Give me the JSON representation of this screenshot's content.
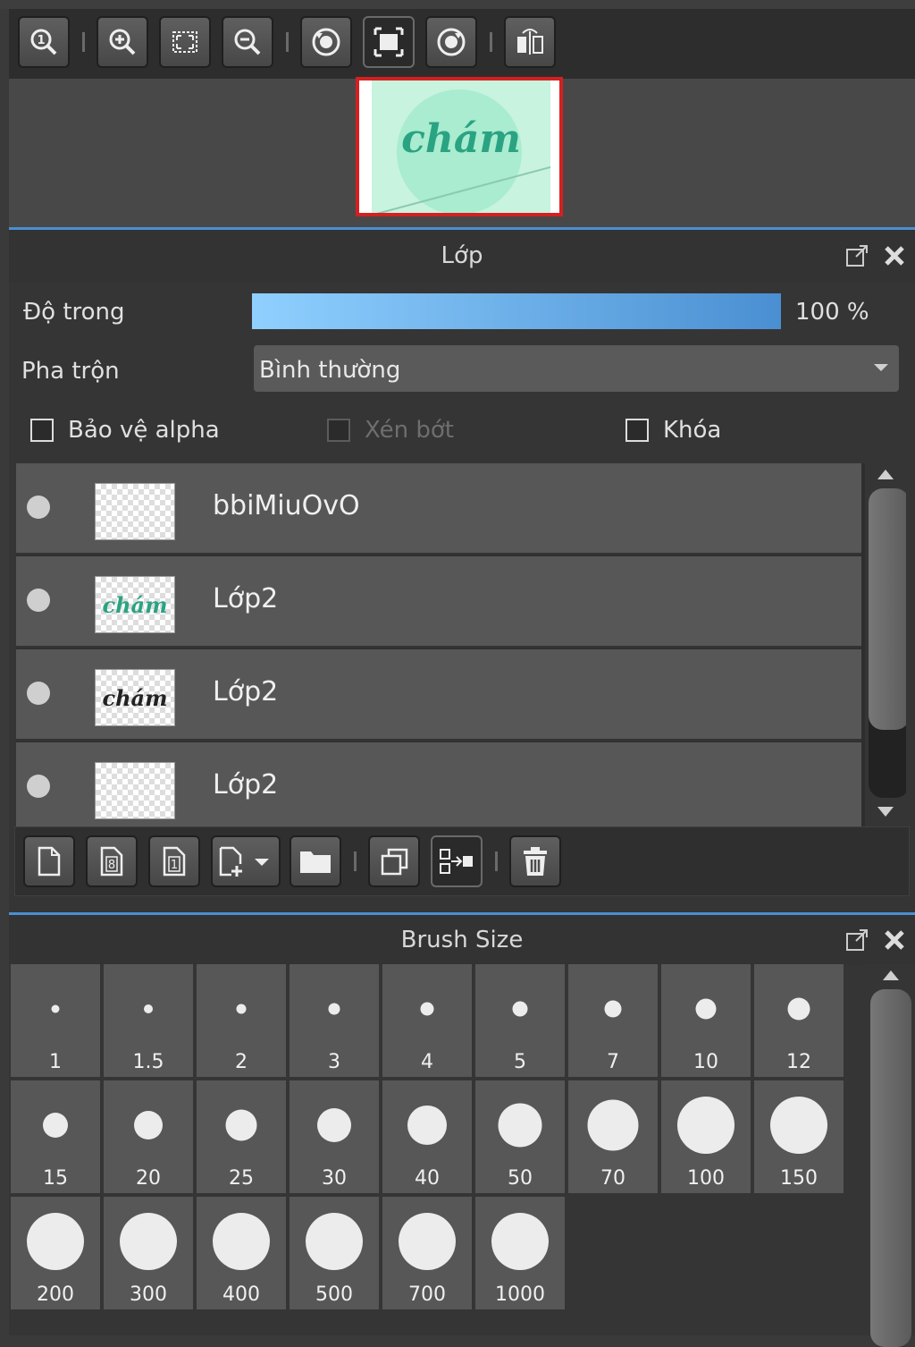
{
  "navigator": {
    "toolbar": [
      "zoom-actual-icon",
      "zoom-in-icon",
      "fit-screen-icon",
      "zoom-out-icon",
      "rotate-left-icon",
      "fit-window-icon",
      "rotate-right-icon",
      "flip-horizontal-icon"
    ],
    "preview_text": "chám",
    "colors": {
      "frame": "#d42020",
      "preview_bg": "#c8f3df",
      "preview_circle": "#a9ecd0",
      "preview_text": "#2aa382"
    }
  },
  "layers_panel": {
    "title": "Lớp",
    "opacity_label": "Độ trong",
    "opacity_value": "100 %",
    "opacity_fraction": 1.0,
    "blend_label": "Pha trộn",
    "blend_value": "Bình thường",
    "protect_alpha_label": "Bảo vệ alpha",
    "clip_label": "Xén bớt",
    "lock_label": "Khóa",
    "layers": [
      {
        "name": "bbiMiuOvO",
        "thumb_text": ""
      },
      {
        "name": "Lớp2",
        "thumb_text": "chám"
      },
      {
        "name": "Lớp2",
        "thumb_text": "chám"
      },
      {
        "name": "Lớp2",
        "thumb_text": ""
      }
    ],
    "toolbar": [
      "new-layer-icon",
      "new-8bit-layer-icon",
      "new-1bit-layer-icon",
      "add-layer-dropdown-icon",
      "folder-icon",
      "duplicate-layer-icon",
      "merge-layer-icon",
      "delete-layer-icon"
    ],
    "colors": {
      "accent": "#4a8fcf",
      "slider_start": "#8fd0ff",
      "slider_end": "#4a8fd2"
    }
  },
  "brush_panel": {
    "title": "Brush Size",
    "sizes": [
      "1",
      "1.5",
      "2",
      "3",
      "4",
      "5",
      "7",
      "10",
      "12",
      "15",
      "20",
      "25",
      "30",
      "40",
      "50",
      "70",
      "100",
      "150",
      "200",
      "300",
      "400",
      "500",
      "700",
      "1000"
    ]
  }
}
